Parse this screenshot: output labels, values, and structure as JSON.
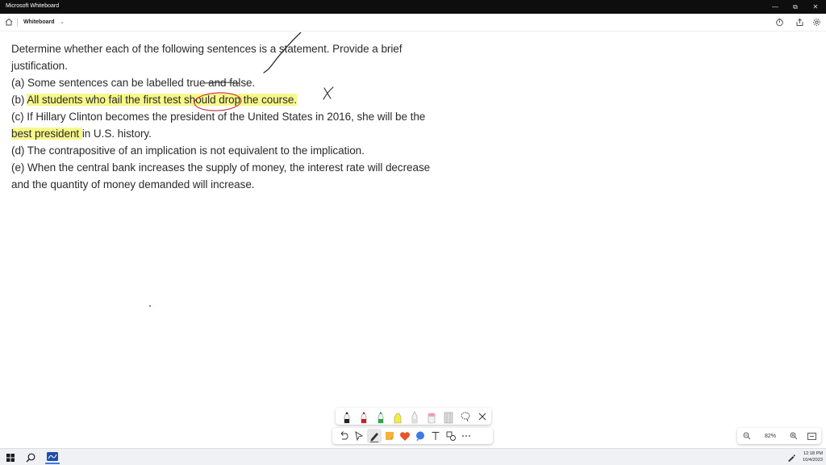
{
  "window": {
    "title": "Microsoft Whiteboard",
    "controls": [
      "minimize",
      "restore",
      "close"
    ]
  },
  "appbar": {
    "board_name": "Whiteboard",
    "icons": [
      "home-icon",
      "chevron-down-icon",
      "timer-icon",
      "share-icon",
      "settings-icon"
    ]
  },
  "content": {
    "lines": [
      "Determine whether each of the following sentences is a statement. Provide a brief",
      "justification.",
      "(a) Some sentences can be labelled true and false.",
      "(b) All students who fail the first test should drop the course.",
      "(c) If Hillary Clinton becomes the president of the United States in 2016, she will be the",
      "best president in U.S. history.",
      "(d) The contrapositive of an implication is not equivalent to the implication.",
      "(e) When the central bank increases the supply of money, the interest rate will decrease",
      "and the quantity of money demanded will increase."
    ],
    "line_b_prefix": "(b) ",
    "line_b_highlight": "All students who fail the first test should drop the course.",
    "line_c2_highlight": "best president ",
    "line_c2_rest": "in U.S. history."
  },
  "annotations": {
    "ink_color": "#2a2a2a",
    "circle_color": "#c0303a",
    "highlight_color": "#f7f78a",
    "mark_x": "X"
  },
  "pen_toolbar": {
    "tools": [
      {
        "name": "black-pen",
        "color": "#222222"
      },
      {
        "name": "red-pen",
        "color": "#c8202a"
      },
      {
        "name": "green-pen",
        "color": "#2aa84a"
      },
      {
        "name": "yellow-highlighter",
        "color": "#f2ee3a"
      },
      {
        "name": "white-pen",
        "color": "#dddddd"
      },
      {
        "name": "pink-eraser",
        "color": "#f3a0a8"
      },
      {
        "name": "ruler",
        "color": "#bbbbbb"
      }
    ]
  },
  "main_toolbar": {
    "tools": [
      "undo-icon",
      "select-icon",
      "inking-icon",
      "sticky-note-icon",
      "reaction-icon",
      "comment-icon",
      "text-icon",
      "shapes-icon",
      "more-icon"
    ]
  },
  "zoom": {
    "level": "82%"
  },
  "taskbar": {
    "time": "12:18 PM",
    "date": "10/4/2023"
  }
}
